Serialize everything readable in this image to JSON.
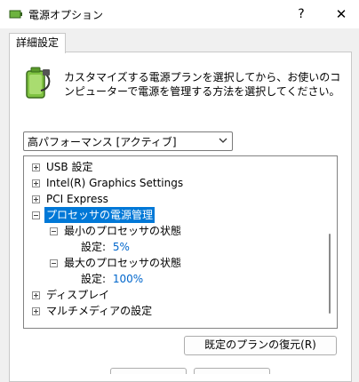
{
  "window": {
    "title": "電源オプション",
    "help_label": "?",
    "close_label": "✕"
  },
  "tab": {
    "label": "詳細設定"
  },
  "description": "カスタマイズする電源プランを選択してから、お使いのコンピューターで電源を管理する方法を選択してください。",
  "plan_select": {
    "selected": "高パフォーマンス [アクティブ]"
  },
  "tree": {
    "items": [
      {
        "label": "USB 設定"
      },
      {
        "label": "Intel(R) Graphics Settings"
      },
      {
        "label": "PCI Express"
      },
      {
        "label": "プロセッサの電源管理"
      },
      {
        "label": "最小のプロセッサの状態"
      },
      {
        "label": "設定:",
        "value": "5%"
      },
      {
        "label": "最大のプロセッサの状態"
      },
      {
        "label": "設定:",
        "value": "100%"
      },
      {
        "label": "ディスプレイ"
      },
      {
        "label": "マルチメディアの設定"
      }
    ]
  },
  "restore_button": {
    "label": "既定のプランの復元(R)"
  },
  "icons": {
    "title": "power-options-icon",
    "plan": "battery-plug-icon",
    "dropdown": "chevron-down-icon",
    "expand": "plus-box-icon",
    "collapse": "minus-box-icon"
  },
  "colors": {
    "selection": "#0078d7",
    "value_link": "#0066cc"
  }
}
